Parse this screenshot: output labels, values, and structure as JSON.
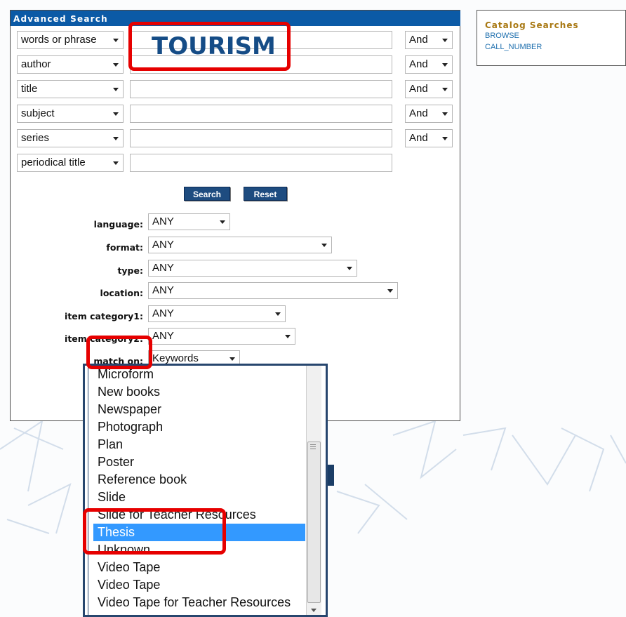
{
  "panel": {
    "header": "Advanced Search"
  },
  "query_rows": [
    {
      "field": "words or phrase",
      "value": "",
      "op": "And"
    },
    {
      "field": "author",
      "value": "",
      "op": "And"
    },
    {
      "field": "title",
      "value": "",
      "op": "And"
    },
    {
      "field": "subject",
      "value": "",
      "op": "And"
    },
    {
      "field": "series",
      "value": "",
      "op": "And"
    },
    {
      "field": "periodical title",
      "value": ""
    }
  ],
  "annotation_text": "TOURISM",
  "buttons": {
    "search": "Search",
    "reset": "Reset"
  },
  "filters": {
    "language": {
      "label": "language:",
      "value": "ANY"
    },
    "format": {
      "label": "format:",
      "value": "ANY"
    },
    "type": {
      "label": "type:",
      "value": "ANY"
    },
    "location": {
      "label": "location:",
      "value": "ANY"
    },
    "item_category1": {
      "label": "item category1:",
      "value": "ANY"
    },
    "item_category2": {
      "label": "item category2:",
      "value": "ANY"
    },
    "match_on": {
      "label": "match on:",
      "value": "Keywords"
    }
  },
  "sidebar": {
    "title": "Catalog Searches",
    "links": [
      "BROWSE",
      "CALL_NUMBER"
    ]
  },
  "dropdown": {
    "items": [
      "Microform",
      "New books",
      "Newspaper",
      "Photograph",
      "Plan",
      "Poster",
      "Reference book",
      "Slide",
      "Slide for Teacher Resources",
      "Thesis",
      "Unknown",
      "Video Tape",
      "Video Tape",
      "Video Tape for Teacher Resources"
    ],
    "selected_index": 9,
    "peek_text": [
      "s",
      "s"
    ]
  },
  "colors": {
    "header": "#0b5aa6",
    "button": "#1e4c80",
    "annotation": "#e60000",
    "selected": "#3399ff"
  }
}
